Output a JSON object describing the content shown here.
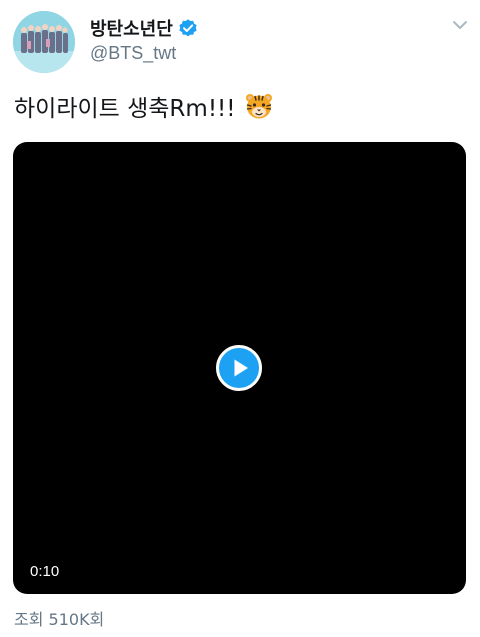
{
  "tweet": {
    "author": {
      "display_name": "방탄소년단",
      "handle": "@BTS_twt",
      "verified": true,
      "avatar_icon": "avatar-group-photo"
    },
    "text": "하이라이트 생축Rm!!!",
    "emoji": "tiger-face",
    "media": {
      "type": "video",
      "duration": "0:10",
      "play_icon": "play-icon"
    },
    "views_text": "조회 510K회",
    "menu_icon": "chevron-down-icon"
  },
  "colors": {
    "primary_text": "#14171a",
    "secondary_text": "#657786",
    "accent": "#1da1f2",
    "video_bg": "#000000"
  }
}
